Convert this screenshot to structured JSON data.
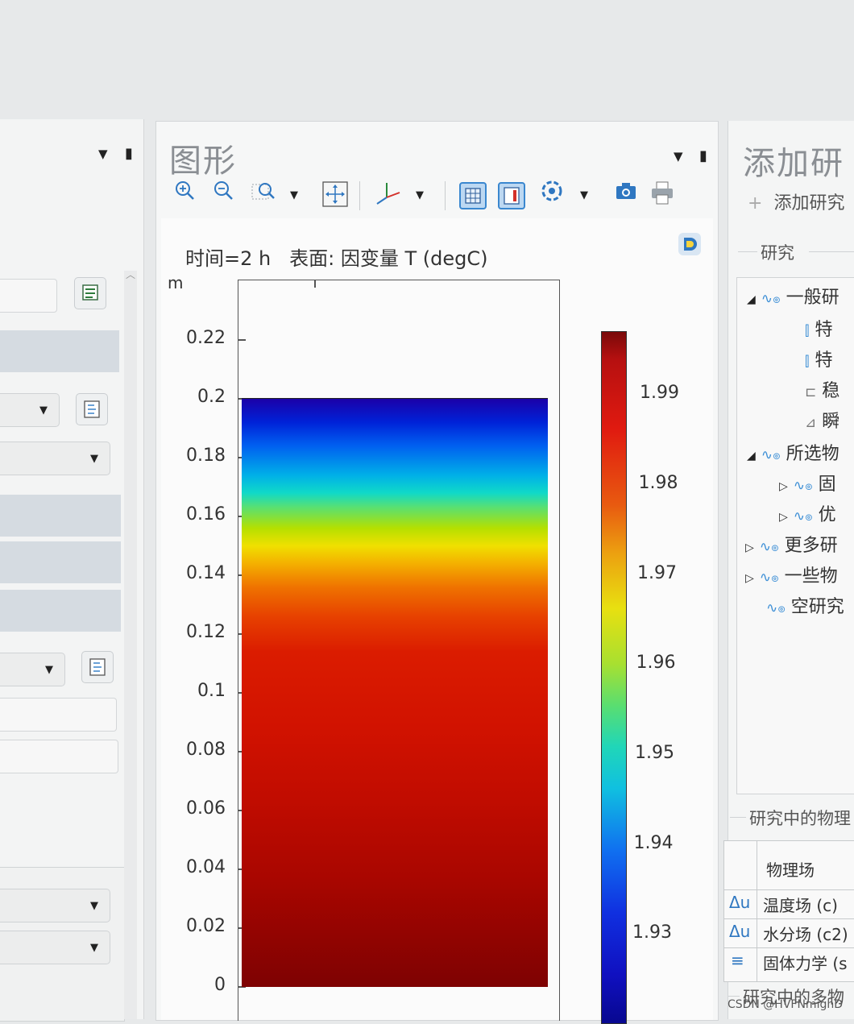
{
  "graphics": {
    "title": "图形",
    "caption": "时间=2 h   表面: 因变量 T (degC)",
    "toolbar": {
      "zoom_in": "zoom-in-icon",
      "zoom_out": "zoom-out-icon",
      "zoom_box": "zoom-box-icon",
      "zoom_extents": "zoom-extents-icon",
      "axis_orientation": "axis-icon",
      "grid": "grid-icon",
      "legend": "legend-icon",
      "scene_light": "scene-light-icon",
      "camera": "camera-icon",
      "print": "print-icon"
    }
  },
  "chart_data": {
    "type": "heatmap",
    "title": "时间=2 h   表面: 因变量 T (degC)",
    "ylabel": "m",
    "y_ticks": [
      "0",
      "0.02",
      "0.04",
      "0.06",
      "0.08",
      "0.1",
      "0.12",
      "0.14",
      "0.16",
      "0.18",
      "0.2",
      "0.22"
    ],
    "ylim": [
      0,
      0.24
    ],
    "domain_top": 0.2,
    "colorbar": {
      "ticks": [
        "1.99",
        "1.98",
        "1.97",
        "1.96",
        "1.95",
        "1.94",
        "1.93"
      ],
      "range": [
        1.92,
        1.997
      ],
      "colormap": "rainbow"
    },
    "profile": [
      {
        "y": 0.2,
        "T": 1.925
      },
      {
        "y": 0.18,
        "T": 1.95
      },
      {
        "y": 0.165,
        "T": 1.965
      },
      {
        "y": 0.15,
        "T": 1.974
      },
      {
        "y": 0.12,
        "T": 1.985
      },
      {
        "y": 0.08,
        "T": 1.989
      },
      {
        "y": 0.04,
        "T": 1.993
      },
      {
        "y": 0,
        "T": 1.997
      }
    ]
  },
  "right": {
    "title": "添加研",
    "add_study": "添加研究",
    "study_section": "研究",
    "tree": [
      {
        "label": "一般研",
        "expanded": true
      },
      {
        "label": "特"
      },
      {
        "label": "特"
      },
      {
        "label": "稳"
      },
      {
        "label": "瞬"
      },
      {
        "label": "所选物",
        "expanded": true
      },
      {
        "label": "固"
      },
      {
        "label": "优"
      },
      {
        "label": "更多研"
      },
      {
        "label": "一些物"
      },
      {
        "label": "空研究"
      }
    ],
    "physics_section": "研究中的物理",
    "physics_header": "物理场",
    "physics_rows": [
      {
        "icon": "Δu",
        "label": "温度场 (c)"
      },
      {
        "icon": "Δu",
        "label": "水分场 (c2)"
      },
      {
        "icon": "≡",
        "label": "固体力学 (s"
      }
    ],
    "bottom_section": "研究中的多物"
  },
  "watermark": "CSDN @HVFNmighD"
}
